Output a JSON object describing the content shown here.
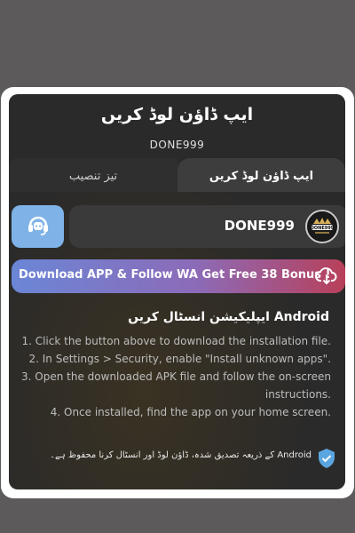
{
  "dialog": {
    "title": "ایپ ڈاؤن لوڈ کریں",
    "subtitle": "DONE999"
  },
  "tabs": {
    "download_label": "ایپ ڈاؤن لوڈ کریں",
    "quick_install_label": "تیز تنصیب"
  },
  "app": {
    "name": "DONE999",
    "logo_text": "DONE999"
  },
  "banner": {
    "text": "Download APP & Follow WA Get Free 38 Bonus !"
  },
  "instructions": {
    "title": "Android ایپلیکیشن انسٹال کریں",
    "steps": [
      "1. Click the button above to download the installation file.",
      "2. In Settings > Security, enable \"Install unknown apps\".",
      "3. Open the downloaded APK file and follow the on-screen instructions.",
      "4. Once installed, find the app on your home screen."
    ]
  },
  "footer": {
    "note": "Android کے ذریعہ تصدیق شدہ، ڈاؤن لوڈ اور انسٹال کرنا محفوظ ہے۔"
  },
  "icons": {
    "support": "headset-icon",
    "download": "cloud-download-icon",
    "verified": "shield-check-icon"
  },
  "colors": {
    "modal_bg": "#2a2a2a",
    "support_button": "#7fb3e8",
    "banner_start": "#6b86d6",
    "banner_end": "#b8405a",
    "shield": "#5aa6e0"
  }
}
